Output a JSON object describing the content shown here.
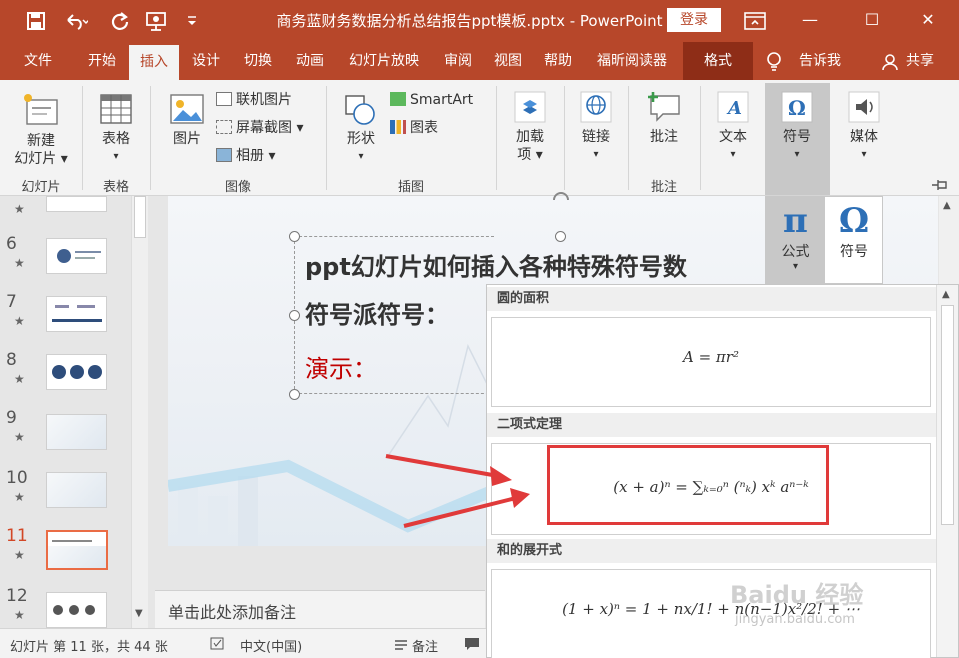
{
  "title_bar": {
    "save_icon": "save-icon",
    "undo_icon": "undo-icon",
    "redo_icon": "redo-icon",
    "present_icon": "present-from-start-icon",
    "qa_more": "quick-access-more-icon",
    "doc_title": "商务蓝财务数据分析总结报告ppt模板.pptx  -  PowerPoint",
    "login": "登录",
    "ribbon_display_icon": "ribbon-display-options-icon",
    "minimize": "—",
    "maximize": "☐",
    "close": "✕"
  },
  "tabs": [
    {
      "label": "文件"
    },
    {
      "label": "开始"
    },
    {
      "label": "插入"
    },
    {
      "label": "设计"
    },
    {
      "label": "切换"
    },
    {
      "label": "动画"
    },
    {
      "label": "幻灯片放映"
    },
    {
      "label": "审阅"
    },
    {
      "label": "视图"
    },
    {
      "label": "帮助"
    },
    {
      "label": "福昕阅读器"
    },
    {
      "label": "格式"
    }
  ],
  "tell_me": "告诉我",
  "share": "共享",
  "ribbon": {
    "new_slide": {
      "line1": "新建",
      "line2": "幻灯片"
    },
    "table": "表格",
    "picture": "图片",
    "online_picture": "联机图片",
    "screenshot": "屏幕截图",
    "album": "相册",
    "shapes": "形状",
    "smartart": "SmartArt",
    "chart": "图表",
    "addins": {
      "line1": "加载",
      "line2": "项"
    },
    "link": "链接",
    "comment": "批注",
    "text": "文本",
    "symbols": "符号",
    "media": "媒体",
    "groups": {
      "slides": "幻灯片",
      "tables": "表格",
      "images": "图像",
      "illustrations": "插图",
      "comments": "批注"
    }
  },
  "symbols_dropdown": {
    "equation_glyph": "π",
    "equation": "公式",
    "symbol_glyph": "Ω",
    "symbol": "符号"
  },
  "thumbnails": [
    {
      "num": "6"
    },
    {
      "num": "7"
    },
    {
      "num": "8"
    },
    {
      "num": "9"
    },
    {
      "num": "10"
    },
    {
      "num": "11"
    },
    {
      "num": "12"
    }
  ],
  "slide": {
    "title": "ppt幻灯片如何插入各种特殊符号数",
    "subtitle": "符号派符号：",
    "demo": "演示："
  },
  "notes_placeholder": "单击此处添加备注",
  "gallery": {
    "sections": [
      {
        "title": "圆的面积",
        "formula": "A = πr²"
      },
      {
        "title": "二项式定理",
        "formula": "(x + a)ⁿ = ∑ₖ₌₀ⁿ (ⁿₖ) xᵏ aⁿ⁻ᵏ"
      },
      {
        "title": "和的展开式",
        "formula": "(1 + x)ⁿ = 1 + nx/1! + n(n−1)x²/2! + ⋯"
      }
    ]
  },
  "status": {
    "slide_info": "幻灯片 第 11 张，共 44 张",
    "language": "中文(中国)",
    "notes": "备注"
  },
  "watermark": {
    "line1": "Baidu 经验",
    "line2": "jingyan.baidu.com"
  }
}
